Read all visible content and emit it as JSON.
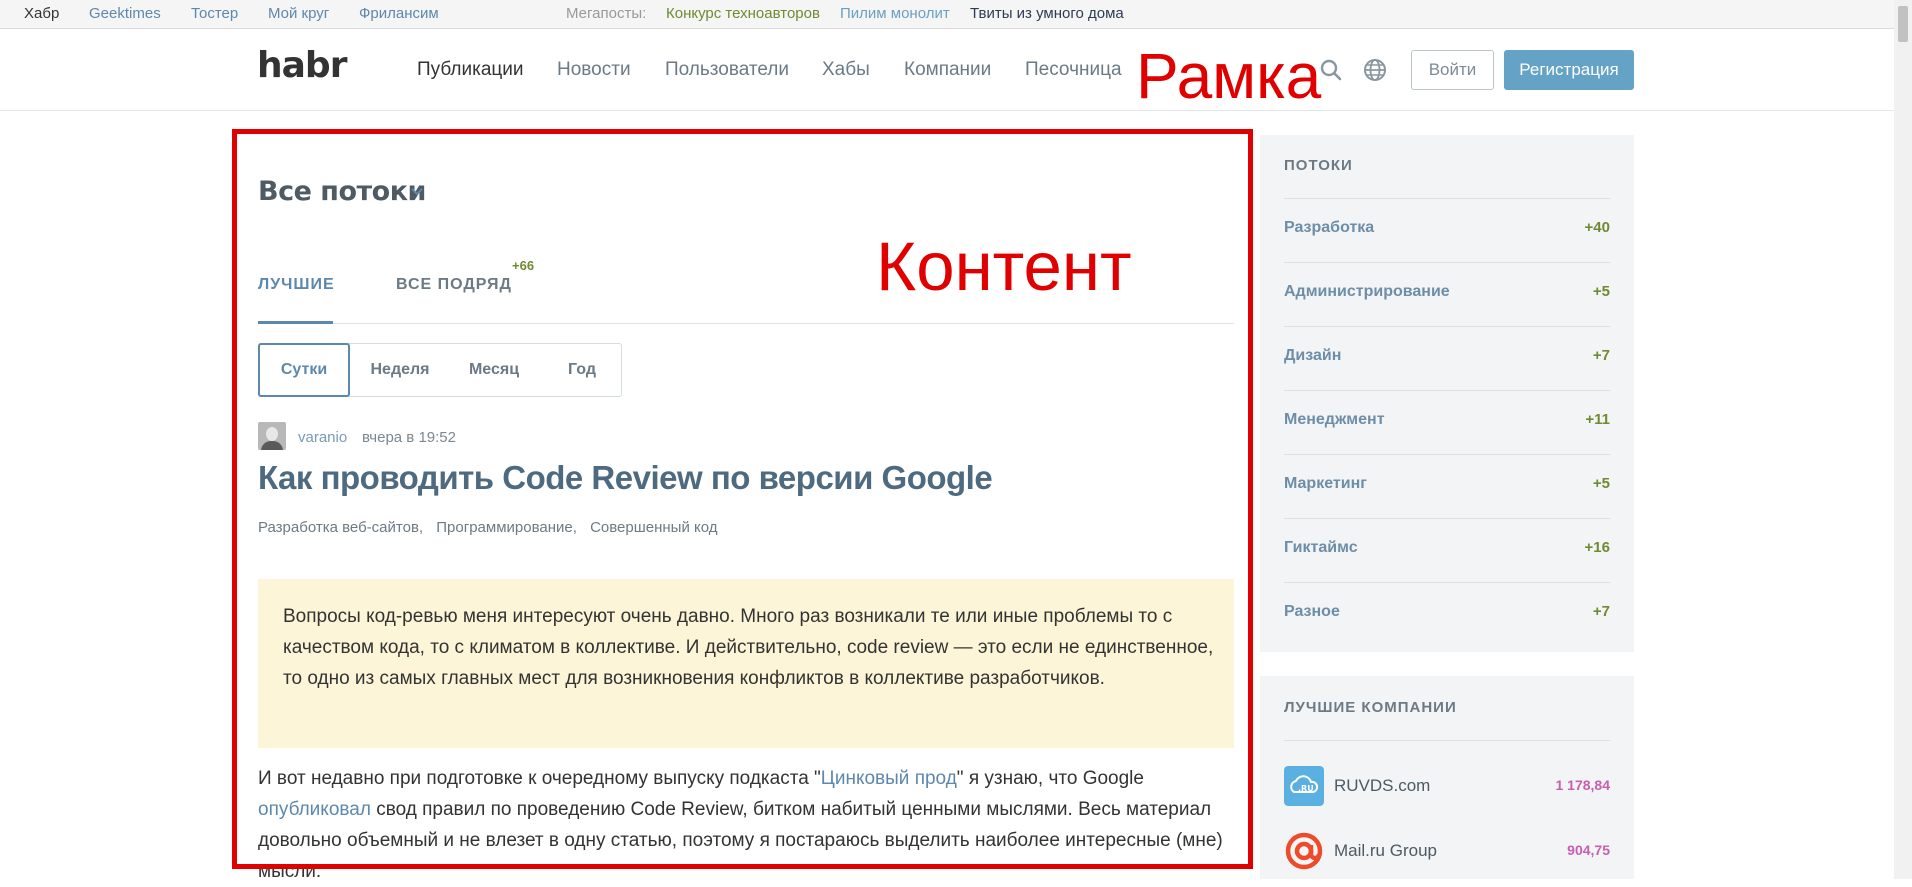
{
  "megabar": {
    "habr": "Хабр",
    "links": [
      "Geektimes",
      "Тостер",
      "Мой круг",
      "Фрилансим"
    ],
    "label": "Мегапосты:",
    "megaposts": [
      "Конкурс техноавторов",
      "Пилим монолит",
      "Твиты из умного дома"
    ]
  },
  "header": {
    "logo": "habr",
    "nav": [
      "Публикации",
      "Новости",
      "Пользователи",
      "Хабы",
      "Компании",
      "Песочница"
    ],
    "login": "Войти",
    "register": "Регистрация"
  },
  "annotations": {
    "frame": "Рамка",
    "content": "Контент"
  },
  "feed": {
    "streams_title": "Все потоки",
    "tabs": {
      "best": "Лучшие",
      "all": "Все подряд",
      "all_count": "+66"
    },
    "periods": [
      "Сутки",
      "Неделя",
      "Месяц",
      "Год"
    ],
    "post": {
      "author": "varanio",
      "time": "вчера в 19:52",
      "title": "Как проводить Code Review по версии Google",
      "hubs": [
        "Разработка веб-сайтов,",
        "Программирование,",
        "Совершенный код"
      ],
      "lead": "Вопросы код-ревью меня интересуют очень давно. Много раз возникали те или иные проблемы то с качеством кода, то с климатом в коллективе. И действительно, code review — это если не единственное, то одно из самых главных мест для возникновения конфликтов в коллективе разработчиков.",
      "body_1": "И вот недавно при подготовке к очередному выпуску подкаста \"",
      "body_link_1": "Цинковый прод",
      "body_2": "\" я узнаю, что Google ",
      "body_link_2": "опубликовал",
      "body_3": " свод правил по проведению Code Review, битком набитый ценными мыслями. Весь материал довольно объемный и не влезет в одну статью, поэтому я постараюсь выделить наиболее интересные (мне) мысли."
    }
  },
  "sidebar": {
    "streams_heading": "Потоки",
    "streams": [
      {
        "name": "Разработка",
        "count": "+40"
      },
      {
        "name": "Администрирование",
        "count": "+5"
      },
      {
        "name": "Дизайн",
        "count": "+7"
      },
      {
        "name": "Менеджмент",
        "count": "+11"
      },
      {
        "name": "Маркетинг",
        "count": "+5"
      },
      {
        "name": "Гиктаймс",
        "count": "+16"
      },
      {
        "name": "Разное",
        "count": "+7"
      }
    ],
    "companies_heading": "Лучшие компании",
    "companies": [
      {
        "name": "RUVDS.com",
        "rating": "1 178,84",
        "logo_text": ".RU",
        "color": "#5ab0e0"
      },
      {
        "name": "Mail.ru Group",
        "rating": "904,75",
        "color": "#ee4a2c"
      }
    ]
  },
  "colors": {
    "annotation": "#e10000",
    "accent": "#5d88ad",
    "register_button": "#65a3c6",
    "positive_count": "#6f8b32",
    "company_rating": "#c75fb0",
    "lead_background": "#fdf5d7"
  }
}
